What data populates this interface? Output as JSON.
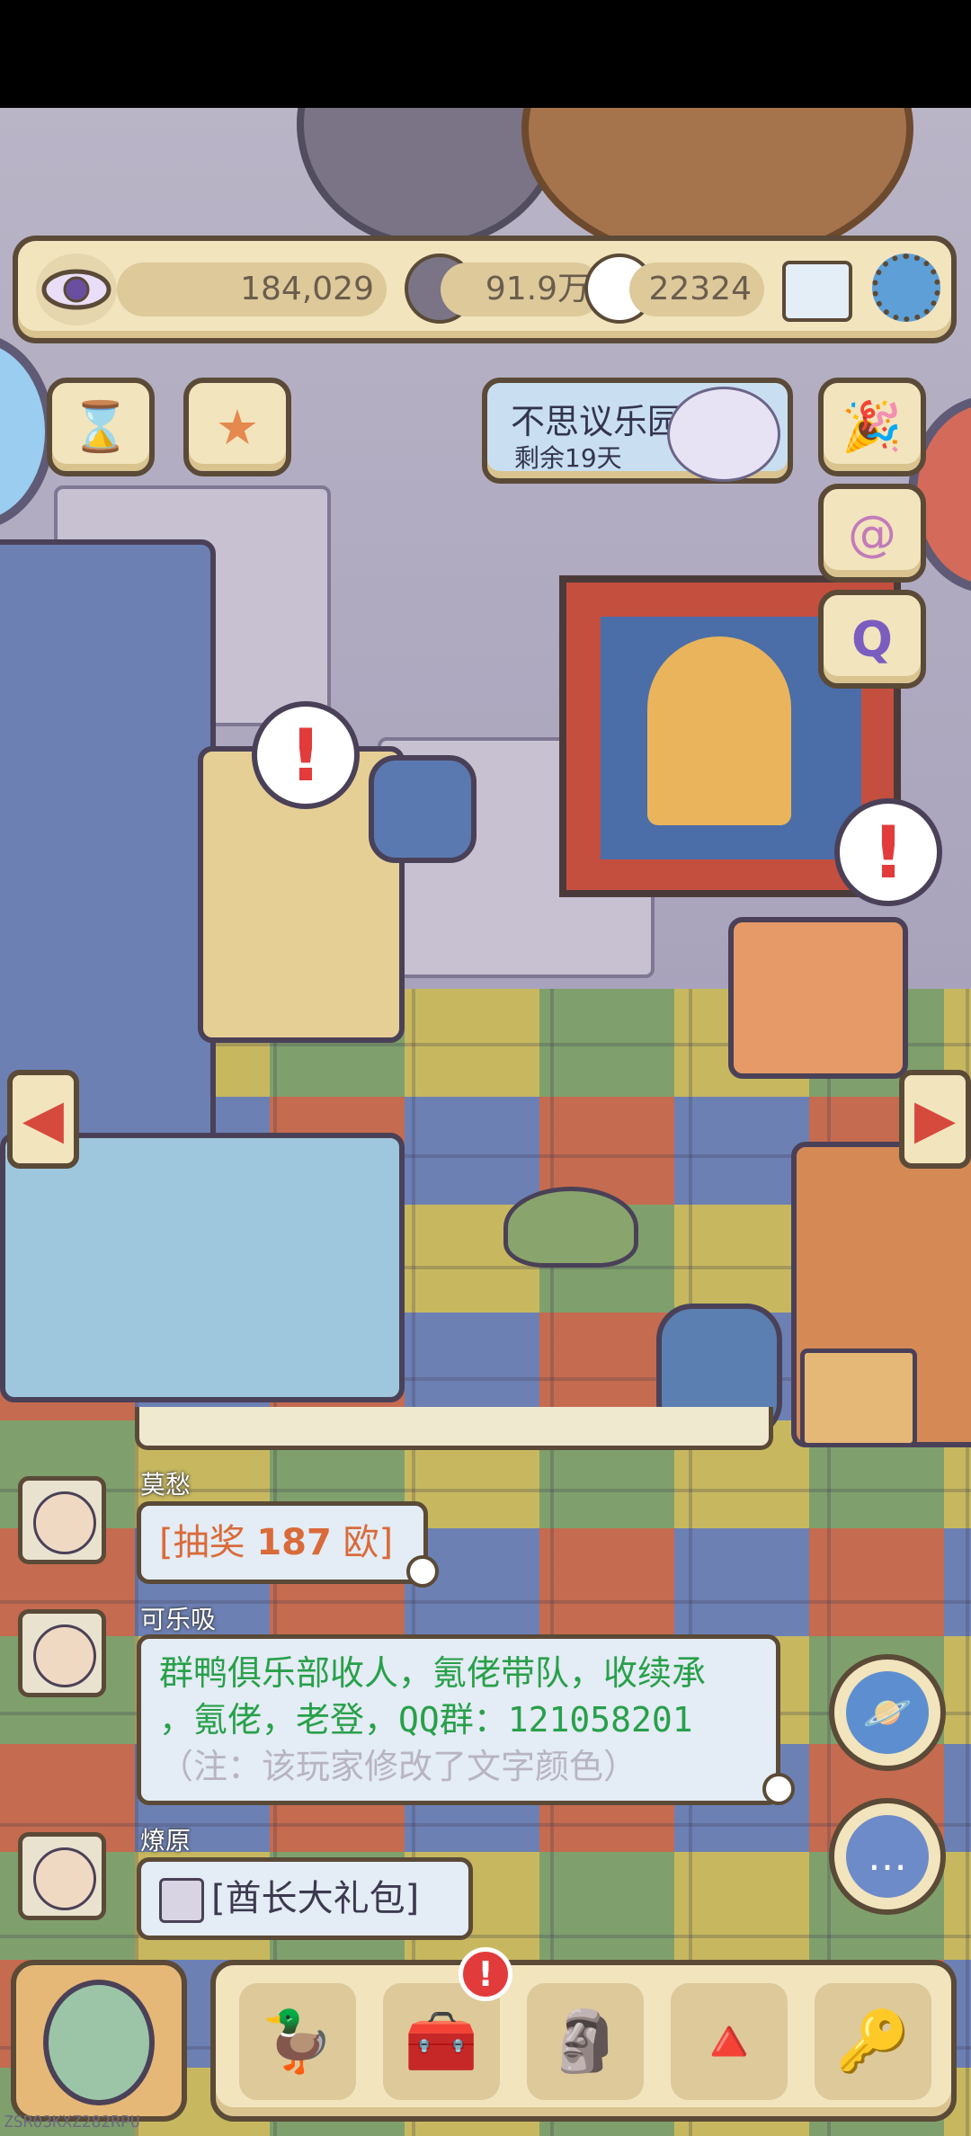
{
  "resources": {
    "eye_count": "184,029",
    "currency1": "91.9万",
    "currency2": "22324"
  },
  "event": {
    "title": "不思议乐园",
    "remaining": "剩余19天"
  },
  "chat": {
    "messages": [
      {
        "user": "莫愁",
        "prefix": "[抽奖 ",
        "number": "187",
        "suffix": " 欧]"
      },
      {
        "user": "可乐吸",
        "line1": "群鸭俱乐部收人，氪佬带队，收续承",
        "line2": "，氪佬，老登，QQ群：121058201",
        "note": "（注：该玩家修改了文字颜色）"
      },
      {
        "user": "燎原",
        "gift": "[酋长大礼包]"
      }
    ]
  },
  "bottom_nav": {
    "badge": "!"
  },
  "alerts": {
    "mark": "!"
  },
  "device_id": "ZSR03KXZ282RPU",
  "icons": {
    "eye": "eye-icon",
    "mail": "mail-icon",
    "settings": "gear-icon",
    "hourglass": "hourglass-icon",
    "star": "star-icon",
    "party": "party-popper-icon",
    "snail": "snail-icon",
    "q": "q-icon",
    "planet": "planet-icon",
    "chat": "chat-bubble-icon"
  }
}
